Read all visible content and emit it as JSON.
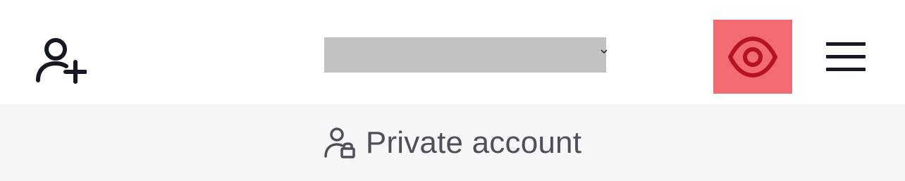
{
  "header": {
    "add_friend_icon": "person-add-icon",
    "username": "",
    "eye_icon": "eye-icon",
    "menu_icon": "hamburger-menu-icon"
  },
  "banner": {
    "icon": "person-lock-icon",
    "label": "Private account"
  },
  "colors": {
    "header_bg": "#ffffff",
    "banner_bg": "#f7f7f7",
    "icon_dark": "#161823",
    "eye_bg": "#f26b73",
    "eye_fg": "#b3141f",
    "banner_text": "#4f4f57",
    "redaction": "#c2c2c2"
  }
}
